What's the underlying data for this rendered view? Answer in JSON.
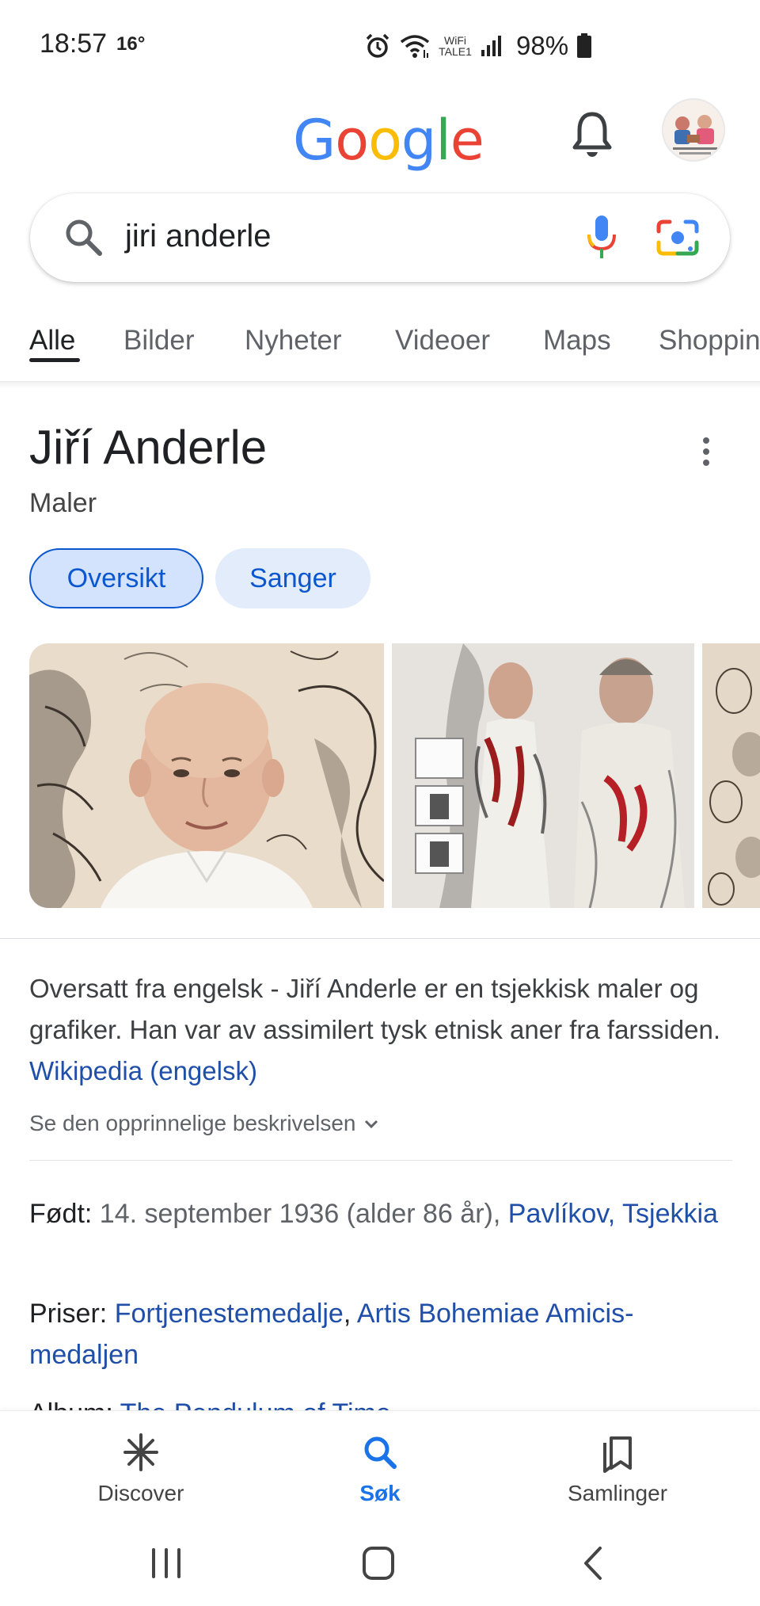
{
  "status_bar": {
    "time": "18:57",
    "temperature": "16°",
    "wifi_label_top": "WiFi",
    "wifi_label_bottom": "TALE1",
    "battery": "98%"
  },
  "header": {
    "logo_text": "Google",
    "logo_colors": [
      "#4285F4",
      "#EA4335",
      "#FBBC05",
      "#4285F4",
      "#34A853",
      "#EA4335"
    ]
  },
  "search": {
    "query": "jiri anderle"
  },
  "tabs": [
    {
      "label": "Alle",
      "active": true
    },
    {
      "label": "Bilder"
    },
    {
      "label": "Nyheter"
    },
    {
      "label": "Videoer"
    },
    {
      "label": "Maps"
    },
    {
      "label": "Shoppin"
    }
  ],
  "knowledge_panel": {
    "title": "Jiří Anderle",
    "subtitle": "Maler",
    "chips": [
      "Oversikt",
      "Sanger"
    ],
    "description_text": "Oversatt fra engelsk - Jiří Anderle er en tsjekkisk maler og grafiker. Han var av assimilert tysk etnisk aner fra farssiden. ",
    "description_link": "Wikipedia (engelsk)",
    "see_original": "Se den opprinnelige beskrivelsen",
    "facts": {
      "born_label": "Født:",
      "born_value": "14. september 1936 (alder 86 år),",
      "born_link": "Pavlíkov, Tsjekkia",
      "awards_label": "Priser:",
      "awards_link_1": "Fortjenestemedalje",
      "awards_sep": ",",
      "awards_link_2": "Artis Bohemiae Amicis-medaljen",
      "album_label": "Album:",
      "album_link": "The Pendulum of Time"
    }
  },
  "bottom_nav": [
    {
      "label": "Discover",
      "icon": "discover-asterisk-icon"
    },
    {
      "label": "Søk",
      "icon": "search-icon",
      "active": true
    },
    {
      "label": "Samlinger",
      "icon": "collections-bookmark-icon"
    }
  ],
  "colors": {
    "accent": "#1a73e8",
    "link": "#1f4fa8",
    "chip_bg": "#d3e3fd"
  }
}
